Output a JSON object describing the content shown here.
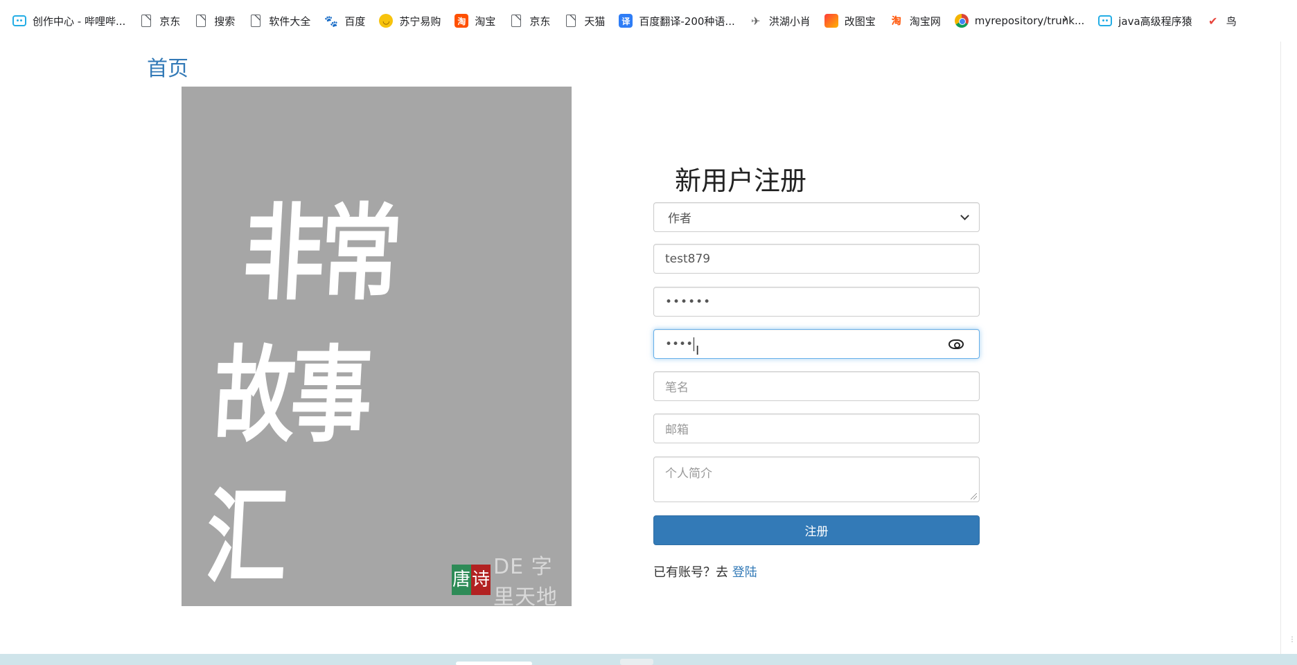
{
  "bookmarks": [
    {
      "label": "创作中心 - 哔哩哔...",
      "icon": "bilibili-icon"
    },
    {
      "label": "京东",
      "icon": "page-icon"
    },
    {
      "label": "搜索",
      "icon": "page-icon"
    },
    {
      "label": "软件大全",
      "icon": "page-icon"
    },
    {
      "label": "百度",
      "icon": "baidu-icon"
    },
    {
      "label": "苏宁易购",
      "icon": "suning-icon"
    },
    {
      "label": "淘宝",
      "icon": "taobao-icon"
    },
    {
      "label": "京东",
      "icon": "page-icon"
    },
    {
      "label": "天猫",
      "icon": "page-icon"
    },
    {
      "label": "百度翻译-200种语...",
      "icon": "translate-icon"
    },
    {
      "label": "洪湖小肖",
      "icon": "bird-icon"
    },
    {
      "label": "改图宝",
      "icon": "gaitubao-icon"
    },
    {
      "label": "淘宝网",
      "icon": "taobao-icon"
    },
    {
      "label": "myrepository/trunk...",
      "icon": "chrome-icon"
    },
    {
      "label": "java高级程序猿",
      "icon": "bilibili-icon"
    },
    {
      "label": "鸟",
      "icon": "bird-icon"
    }
  ],
  "bookmarks_more": "›",
  "nav": {
    "home": "首页"
  },
  "cover": {
    "title_line1": "非常",
    "title_line2": "故事汇",
    "seal1": "唐",
    "seal2": "诗",
    "logo_text": "DE 字里天地"
  },
  "form": {
    "title": "新用户注册",
    "role_selected": "作者",
    "username": "test879",
    "password": "••••••",
    "confirm_password": "••••",
    "penname_placeholder": "笔名",
    "email_placeholder": "邮箱",
    "bio_placeholder": "个人简介",
    "submit": "注册",
    "login_prompt": "已有账号？去 ",
    "login_link": "登陆"
  },
  "colors": {
    "primary": "#337ab7",
    "cover_bg": "#a6a6a6"
  }
}
